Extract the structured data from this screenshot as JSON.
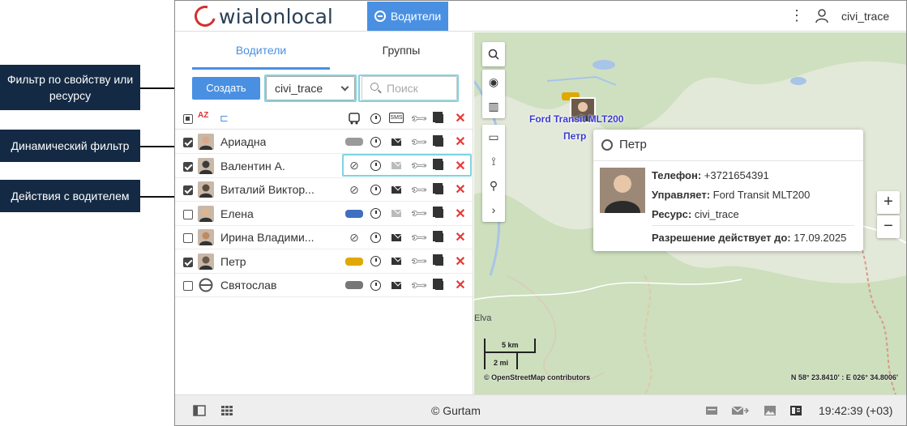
{
  "app": {
    "logo_text": "wialon",
    "logo_text2": "local",
    "nav_button": "Водители",
    "username": "civi_trace"
  },
  "panel": {
    "tabs": [
      "Водители",
      "Группы"
    ],
    "create_label": "Создать",
    "filter_value": "civi_trace",
    "search_placeholder": "Поиск",
    "sort_label": "AZ"
  },
  "drivers": [
    {
      "name": "Ариадна",
      "checked": true,
      "vehicle_color": "#9a9a9a",
      "mail_dim": false,
      "linked": true
    },
    {
      "name": "Валентин А.",
      "checked": true,
      "vehicle_color": "",
      "mail_dim": true,
      "linked": false
    },
    {
      "name": "Виталий Виктор...",
      "checked": true,
      "vehicle_color": "",
      "mail_dim": false,
      "linked": false
    },
    {
      "name": "Елена",
      "checked": false,
      "vehicle_color": "#3f6fbf",
      "mail_dim": true,
      "linked": true
    },
    {
      "name": "Ирина Владими...",
      "checked": false,
      "vehicle_color": "",
      "mail_dim": false,
      "linked": false
    },
    {
      "name": "Петр",
      "checked": true,
      "vehicle_color": "#e0a800",
      "mail_dim": false,
      "linked": true
    },
    {
      "name": "Святослав",
      "checked": false,
      "vehicle_color": "#777777",
      "mail_dim": false,
      "linked": true
    }
  ],
  "map": {
    "unit_label": "Ford Transit MLT200",
    "driver_label": "Петр",
    "scale_km": "5 km",
    "scale_mi": "2 mi",
    "attribution": "© OpenStreetMap contributors",
    "coordinates": "N 58° 23.8410' : E 026° 34.8006'",
    "town": "Elva",
    "zoom_in": "+",
    "zoom_out": "−"
  },
  "popup": {
    "title": "Петр",
    "phone_label": "Телефон:",
    "phone": "+3721654391",
    "drives_label": "Управляет:",
    "drives": "Ford Transit MLT200",
    "resource_label": "Ресурс:",
    "resource": "civi_trace",
    "permit_label": "Разрешение действует до:",
    "permit": "17.09.2025"
  },
  "footer": {
    "copyright": "© Gurtam",
    "time": "19:42:39 (+03)"
  },
  "annotations": {
    "filter": "Фильтр по свойству или ресурсу",
    "dynamic": "Динамический фильтр",
    "actions": "Действия с водителем"
  },
  "colors": {
    "accent": "#4a90e2",
    "delete": "#e53935",
    "annotation_bg": "#142a44",
    "highlight": "#7fd4e0"
  }
}
